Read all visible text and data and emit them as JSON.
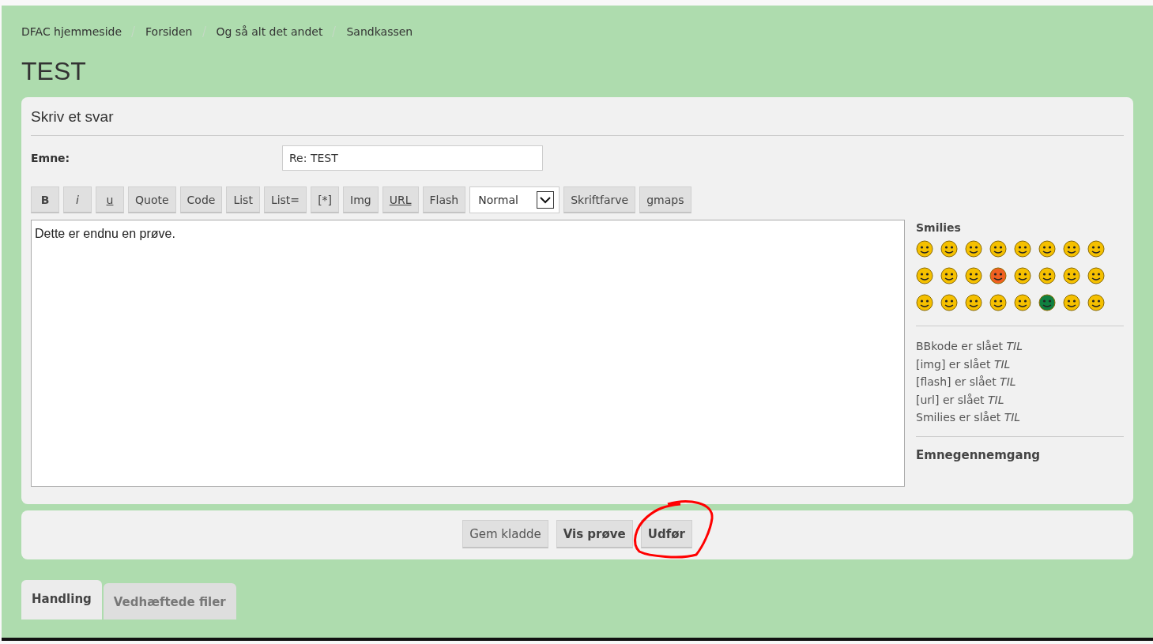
{
  "breadcrumbs": [
    "DFAC hjemmeside",
    "Forsiden",
    "Og så alt det andet",
    "Sandkassen"
  ],
  "title": "TEST",
  "reply_panel": {
    "heading": "Skriv et svar",
    "subject_label": "Emne:",
    "subject_value": "Re: TEST",
    "toolbar": [
      {
        "label": "B",
        "kind": "bold"
      },
      {
        "label": "i",
        "kind": "italic"
      },
      {
        "label": "u",
        "kind": "underline"
      },
      {
        "label": "Quote",
        "kind": "plain"
      },
      {
        "label": "Code",
        "kind": "plain"
      },
      {
        "label": "List",
        "kind": "plain"
      },
      {
        "label": "List=",
        "kind": "plain"
      },
      {
        "label": "[*]",
        "kind": "plain"
      },
      {
        "label": "Img",
        "kind": "plain"
      },
      {
        "label": "URL",
        "kind": "underline"
      },
      {
        "label": "Flash",
        "kind": "plain"
      },
      {
        "label": "Normal",
        "kind": "select"
      },
      {
        "label": "Skriftfarve",
        "kind": "plain"
      },
      {
        "label": "gmaps",
        "kind": "plain"
      }
    ],
    "message": "Dette er endnu en prøve.",
    "smilies_heading": "Smilies",
    "smilies": [
      {
        "color": "#f5c000"
      },
      {
        "color": "#f5c000"
      },
      {
        "color": "#f5c000"
      },
      {
        "color": "#f5c000"
      },
      {
        "color": "#f5c000"
      },
      {
        "color": "#f5c000"
      },
      {
        "color": "#f5c000"
      },
      {
        "color": "#f5c000"
      },
      {
        "color": "#f5c000"
      },
      {
        "color": "#f5c000"
      },
      {
        "color": "#f5c000"
      },
      {
        "color": "#f06020"
      },
      {
        "color": "#f5c000"
      },
      {
        "color": "#f5c000"
      },
      {
        "color": "#f5c000"
      },
      {
        "color": "#f5c000"
      },
      {
        "color": "#f5c000"
      },
      {
        "color": "#f5c000"
      },
      {
        "color": "#f5c000"
      },
      {
        "color": "#f5c000"
      },
      {
        "color": "#f5c000"
      },
      {
        "color": "#108040"
      },
      {
        "color": "#f5c000"
      },
      {
        "color": "#f5c000"
      }
    ],
    "status_lines": [
      "BBkode er slået *TIL*",
      "[img] er slået *TIL*",
      "[flash] er slået *TIL*",
      "[url] er slået *TIL*",
      "Smilies er slået *TIL*"
    ],
    "topic_review": "Emnegennemgang"
  },
  "actions": [
    {
      "label": "Gem kladde",
      "bold": false,
      "circled": false
    },
    {
      "label": "Vis prøve",
      "bold": true,
      "circled": false
    },
    {
      "label": "Udfør",
      "bold": true,
      "circled": true
    }
  ],
  "tabs": [
    {
      "label": "Handling",
      "selected": true
    },
    {
      "label": "Vedhæftede filer",
      "selected": false
    }
  ]
}
